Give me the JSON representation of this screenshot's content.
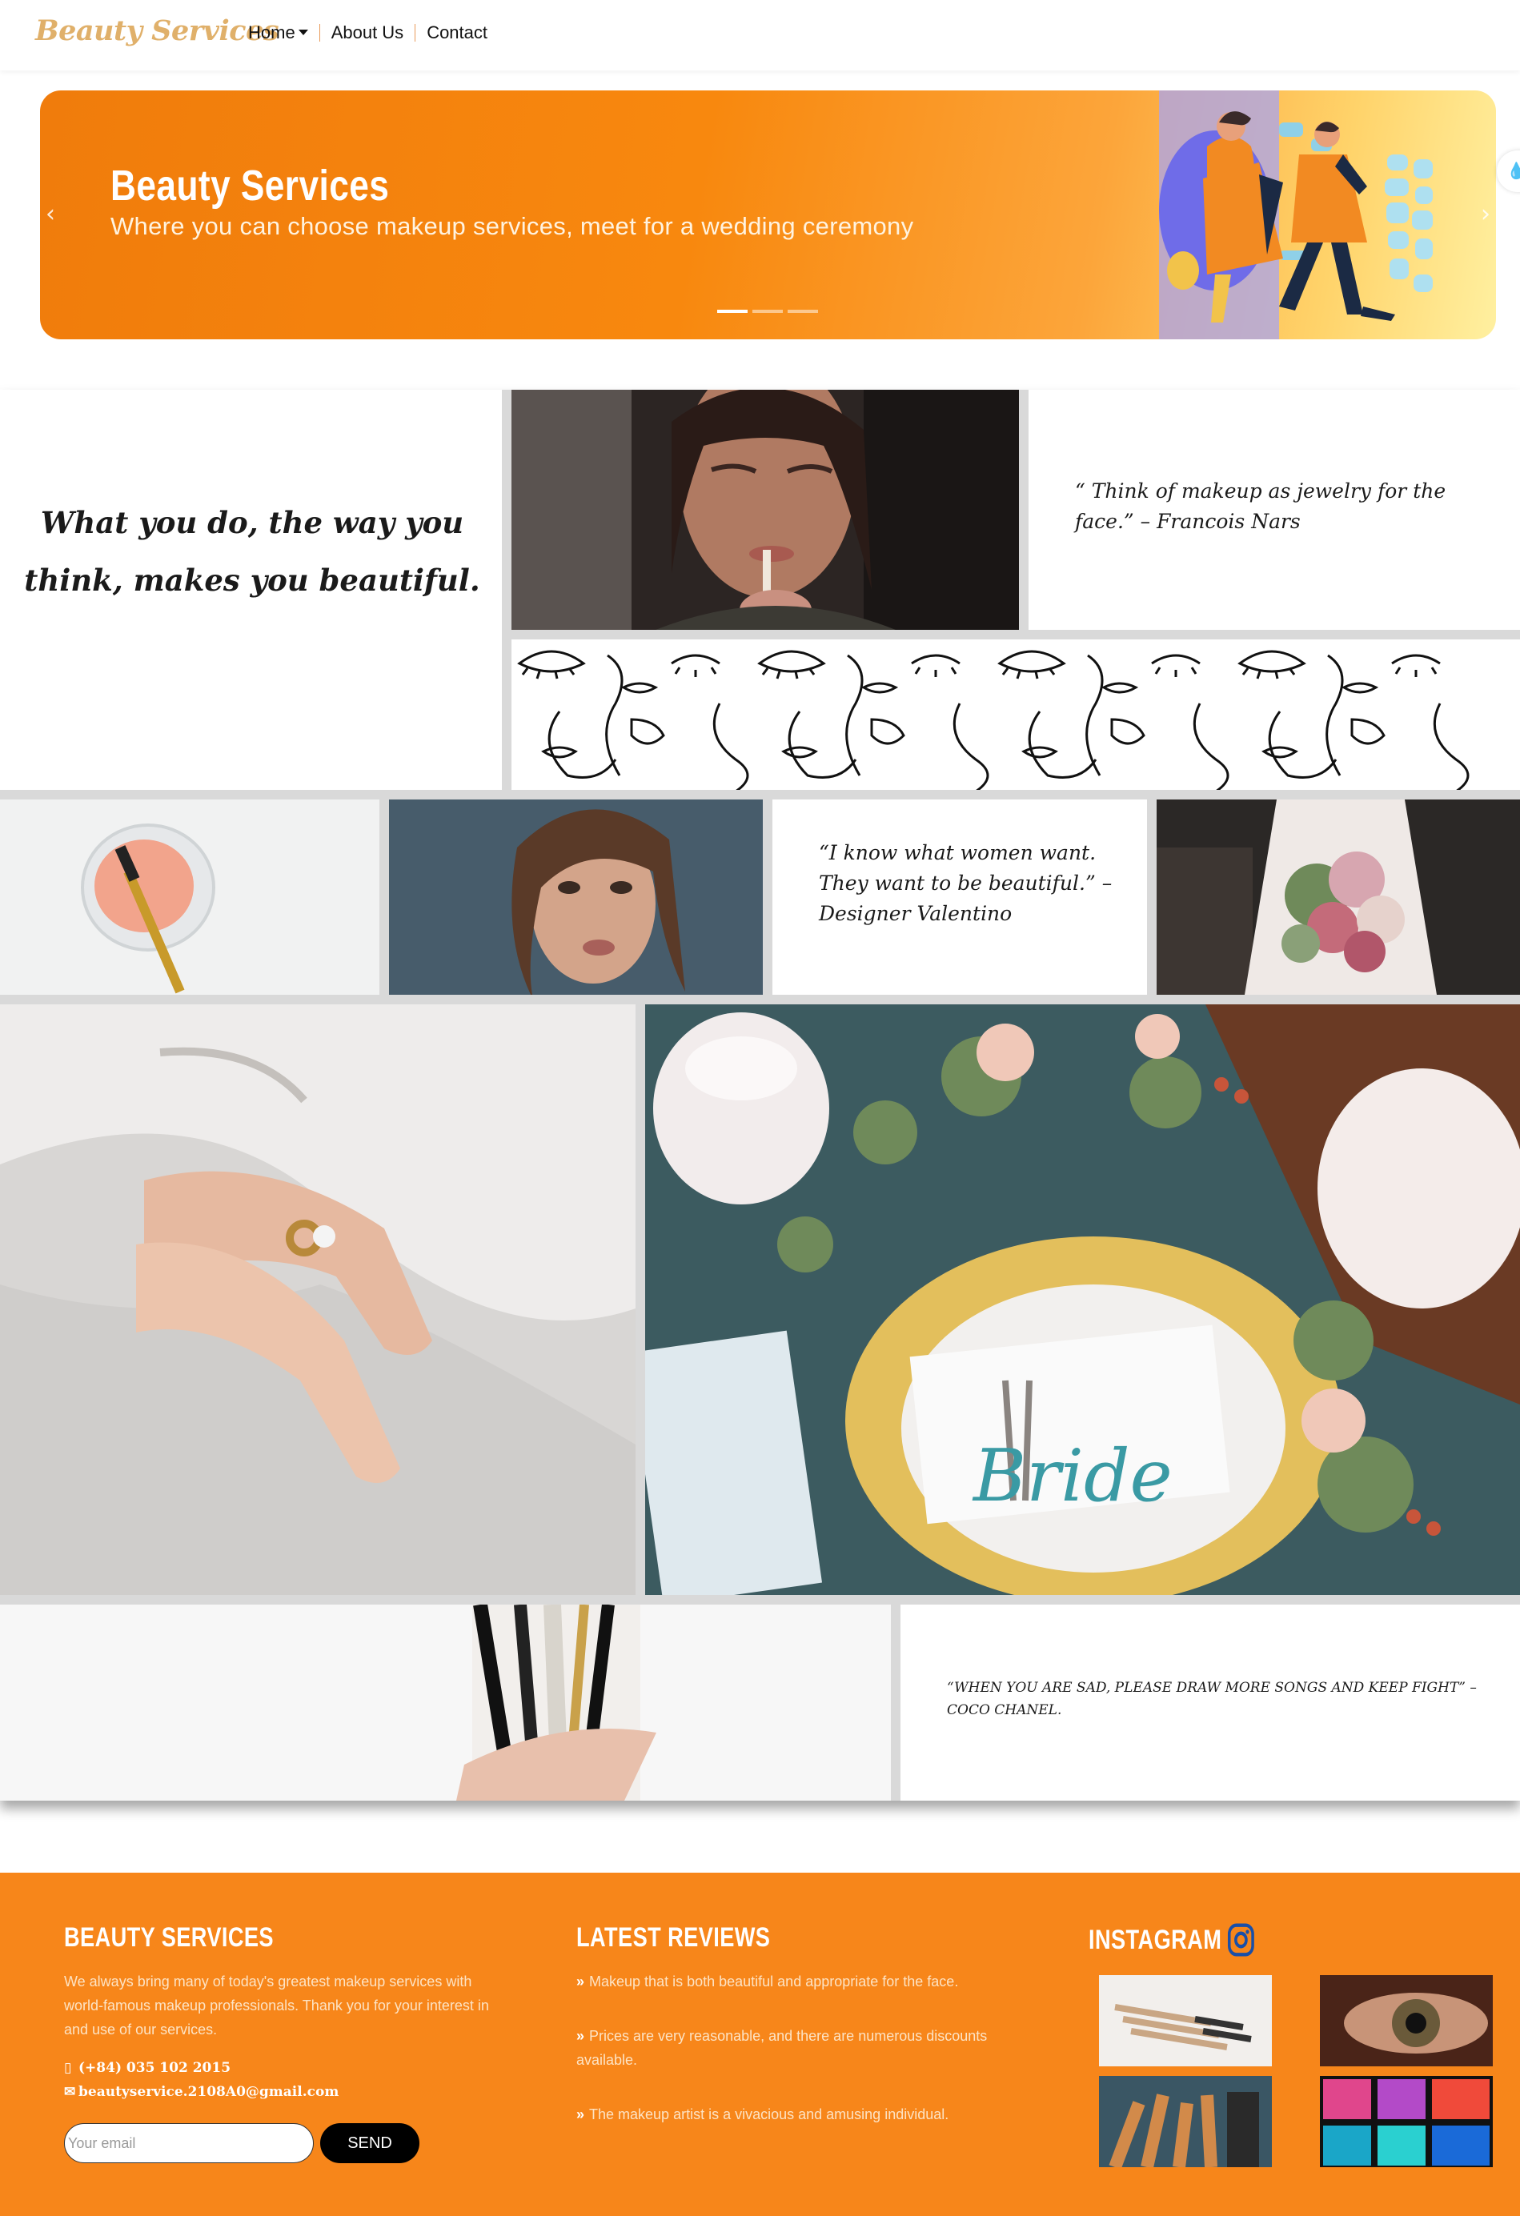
{
  "brand": "Beauty Services",
  "nav": {
    "home": "Home",
    "about": "About Us",
    "contact": "Contact"
  },
  "hero": {
    "title": "Beauty Services",
    "subtitle": "Where you can choose makeup services, meet for a wedding ceremony",
    "prev_icon": "chevron-left-icon",
    "next_icon": "chevron-right-icon",
    "slides": 3,
    "active_slide": 1
  },
  "gallery": {
    "quote_main": "What you do, the way you think, makes you beautiful.",
    "quote_nars": "“ Think of makeup as jewelry for the face.” – Francois Nars",
    "quote_valentino": "“I know what women want. They want to be beautiful.” – Designer Valentino",
    "quote_chanel": "“When you are sad, please draw more songs and keep fight” – Coco Chanel."
  },
  "footer": {
    "about_title": "Beauty Services",
    "about_text": "We always bring many of today's greatest makeup services with world-famous makeup professionals. Thank you for your interest in and use of our services.",
    "phone": "(+84) 035 102 2015",
    "email": "beautyservice.2108A0@gmail.com",
    "email_placeholder": "Your email",
    "send_label": "SEND",
    "reviews_title": "Latest Reviews",
    "reviews": [
      "Makeup that is both beautiful and appropriate for the face.",
      "Prices are very reasonable, and there are numerous discounts available.",
      "The makeup artist is a vivacious and amusing individual."
    ],
    "instagram_title": "Instagram"
  },
  "colors": {
    "accent": "#f7861a",
    "brand": "#e0b06a",
    "hero_start": "#f07c0c",
    "hero_end": "#fff0a0"
  }
}
